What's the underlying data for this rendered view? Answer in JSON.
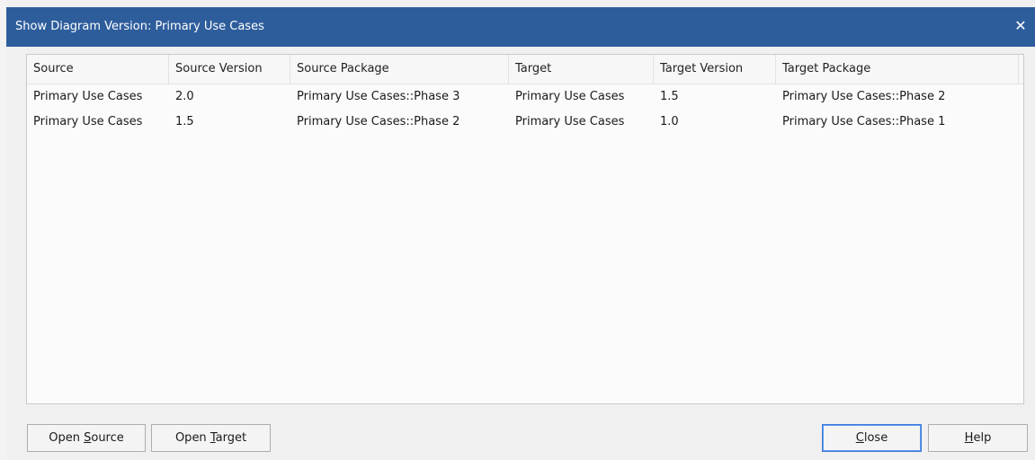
{
  "window": {
    "title": "Show Diagram Version: Primary Use Cases",
    "close_glyph": "✕"
  },
  "table": {
    "columns": [
      "Source",
      "Source Version",
      "Source Package",
      "Target",
      "Target Version",
      "Target Package"
    ],
    "rows": [
      [
        "Primary Use Cases",
        "2.0",
        "Primary Use Cases::Phase 3",
        "Primary Use Cases",
        "1.5",
        "Primary Use Cases::Phase 2"
      ],
      [
        "Primary Use Cases",
        "1.5",
        "Primary Use Cases::Phase 2",
        "Primary Use Cases",
        "1.0",
        "Primary Use Cases::Phase 1"
      ]
    ]
  },
  "buttons": {
    "open_source": {
      "pre": "Open ",
      "accel": "S",
      "post": "ource"
    },
    "open_target": {
      "pre": "Open ",
      "accel": "T",
      "post": "arget"
    },
    "close": {
      "pre": "",
      "accel": "C",
      "post": "lose"
    },
    "help": {
      "pre": "",
      "accel": "H",
      "post": "elp"
    }
  },
  "colors": {
    "titlebar": "#2e5d9c",
    "dialog_bg": "#f0f0f0",
    "default_button_border": "#3b7ad8"
  }
}
